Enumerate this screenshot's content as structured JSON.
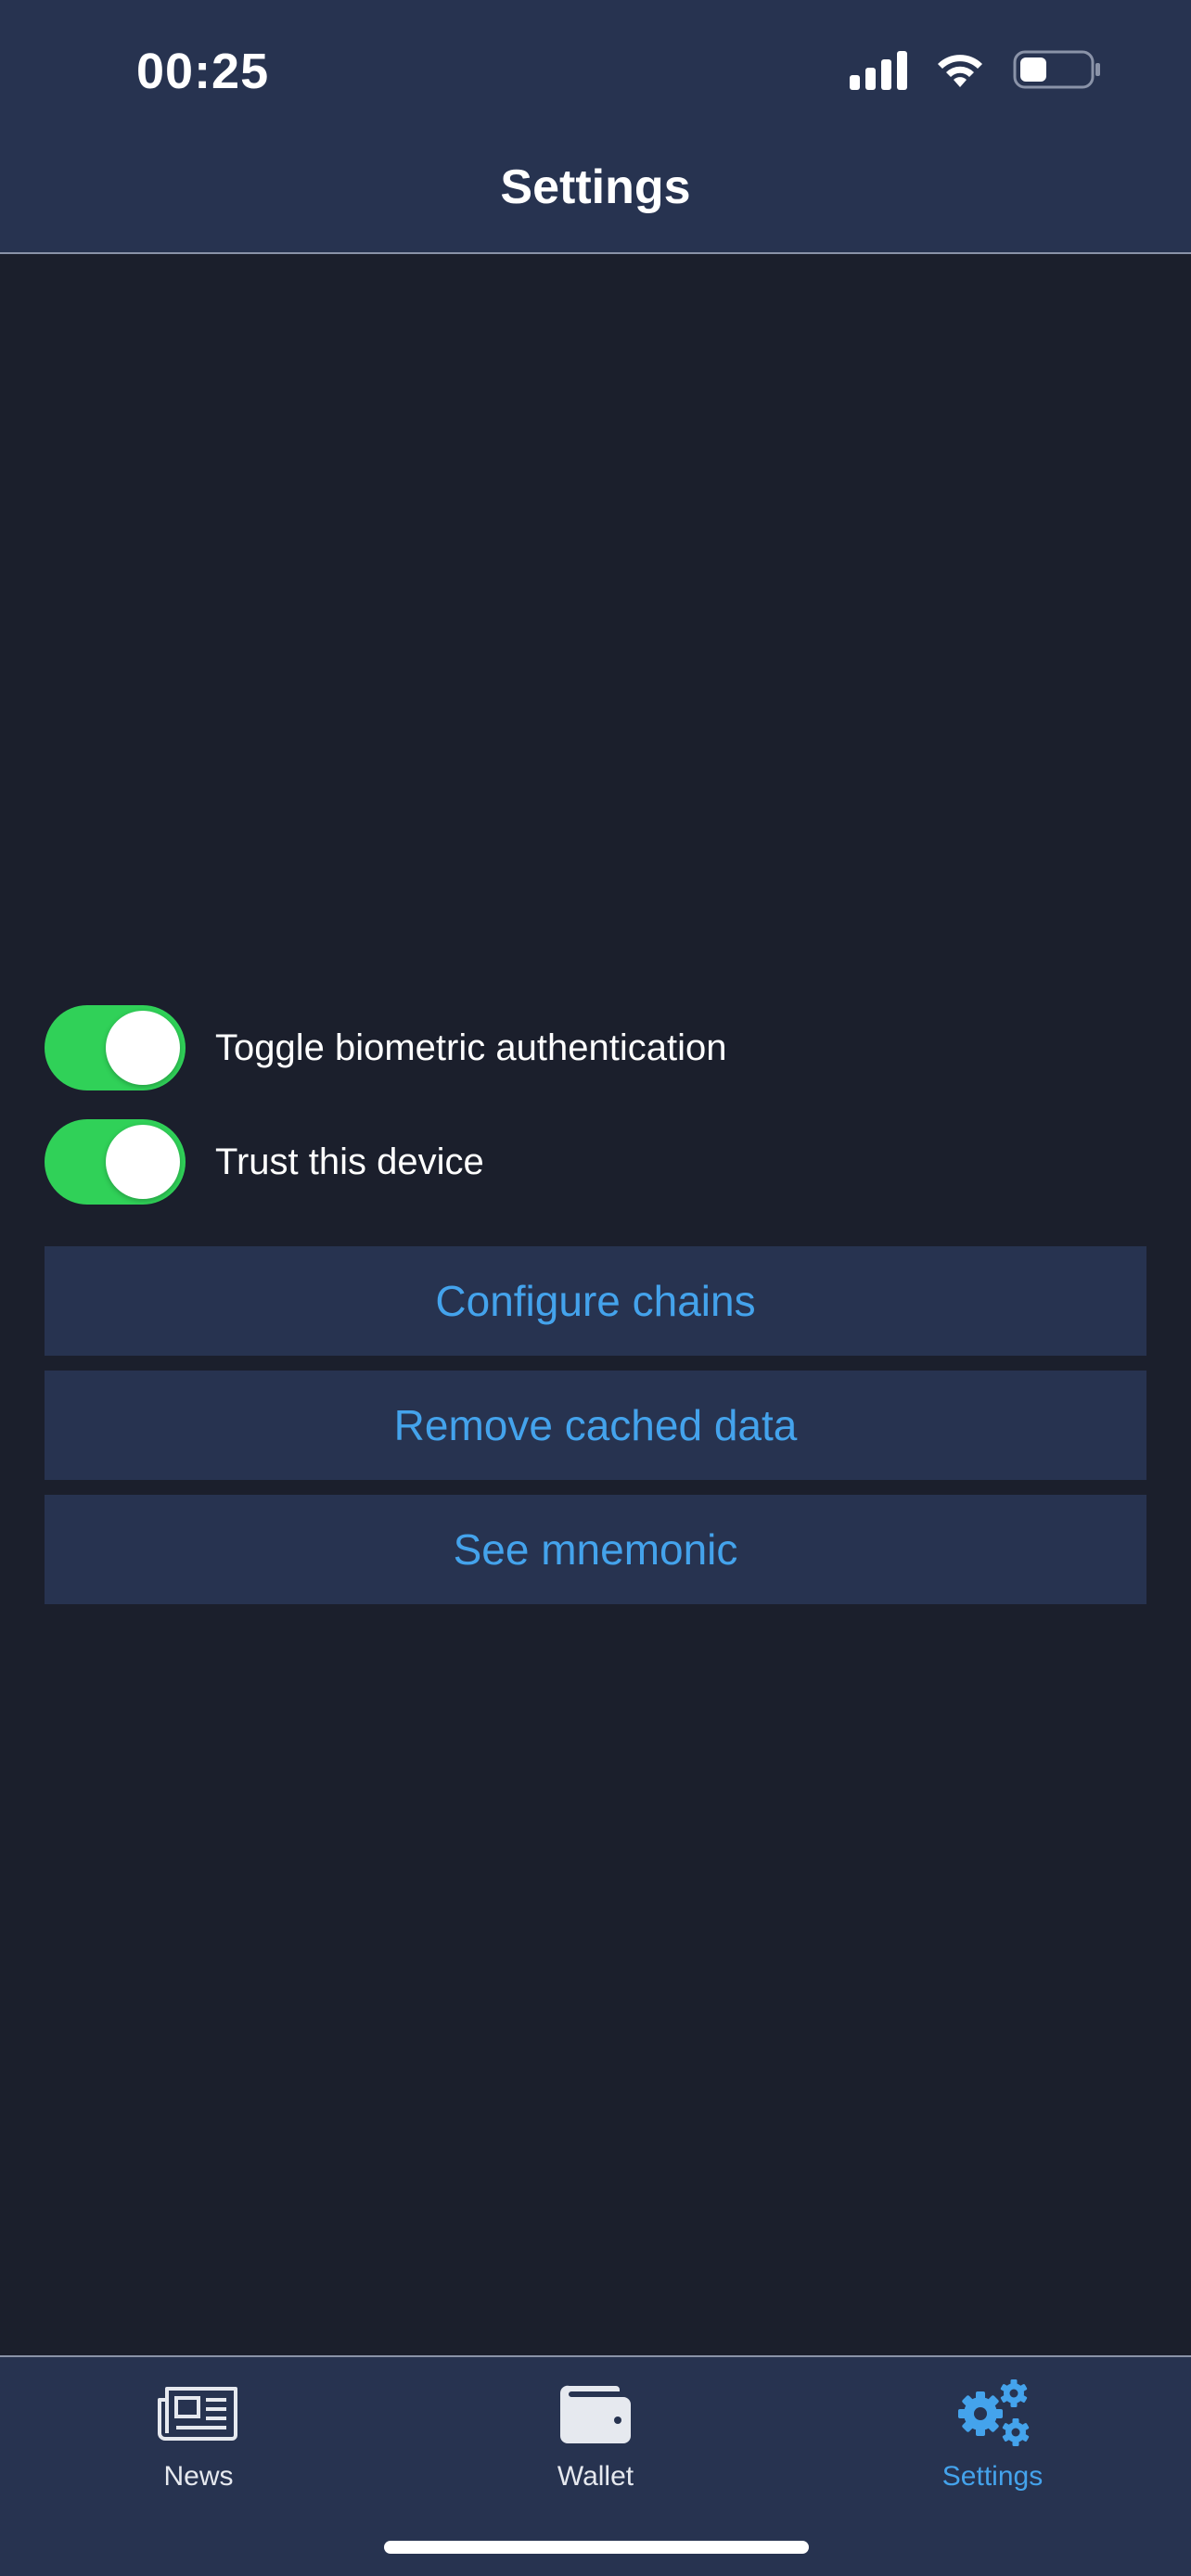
{
  "status_bar": {
    "time": "00:25"
  },
  "header": {
    "title": "Settings"
  },
  "toggles": [
    {
      "label": "Toggle biometric authentication",
      "on": true
    },
    {
      "label": "Trust this device",
      "on": true
    }
  ],
  "actions": [
    {
      "label": "Configure chains"
    },
    {
      "label": "Remove cached data"
    },
    {
      "label": "See mnemonic"
    }
  ],
  "tabbar": {
    "tabs": [
      {
        "label": "News",
        "icon": "newspaper-icon",
        "active": false
      },
      {
        "label": "Wallet",
        "icon": "wallet-icon",
        "active": false
      },
      {
        "label": "Settings",
        "icon": "gears-icon",
        "active": true
      }
    ]
  },
  "colors": {
    "background": "#1b1f2c",
    "header": "#273350",
    "accent": "#44a3ec",
    "toggle_on": "#30d158"
  }
}
